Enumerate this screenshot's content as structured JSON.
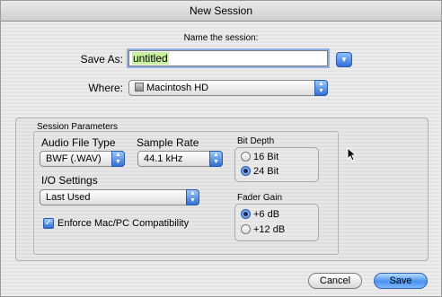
{
  "window": {
    "title": "New Session"
  },
  "name_session": {
    "subtitle": "Name the session:",
    "save_as_label": "Save As:",
    "save_as_value": "untitled",
    "where_label": "Where:",
    "where_value": "Macintosh HD"
  },
  "params": {
    "title": "Session Parameters",
    "audio_file_type_label": "Audio File Type",
    "audio_file_type_value": "BWF (.WAV)",
    "sample_rate_label": "Sample Rate",
    "sample_rate_value": "44.1 kHz",
    "io_settings_label": "I/O Settings",
    "io_settings_value": "Last Used",
    "enforce_label": "Enforce Mac/PC Compatibility",
    "enforce_checked": true,
    "bit_depth_label": "Bit Depth",
    "bit_depth_options": [
      "16 Bit",
      "24 Bit"
    ],
    "bit_depth_selected": "24 Bit",
    "fader_gain_label": "Fader Gain",
    "fader_gain_options": [
      "+6 dB",
      "+12 dB"
    ],
    "fader_gain_selected": "+6 dB"
  },
  "buttons": {
    "cancel": "Cancel",
    "save": "Save"
  },
  "colors": {
    "accent": "#2f6fd6",
    "selection": "#c8f0a0"
  }
}
